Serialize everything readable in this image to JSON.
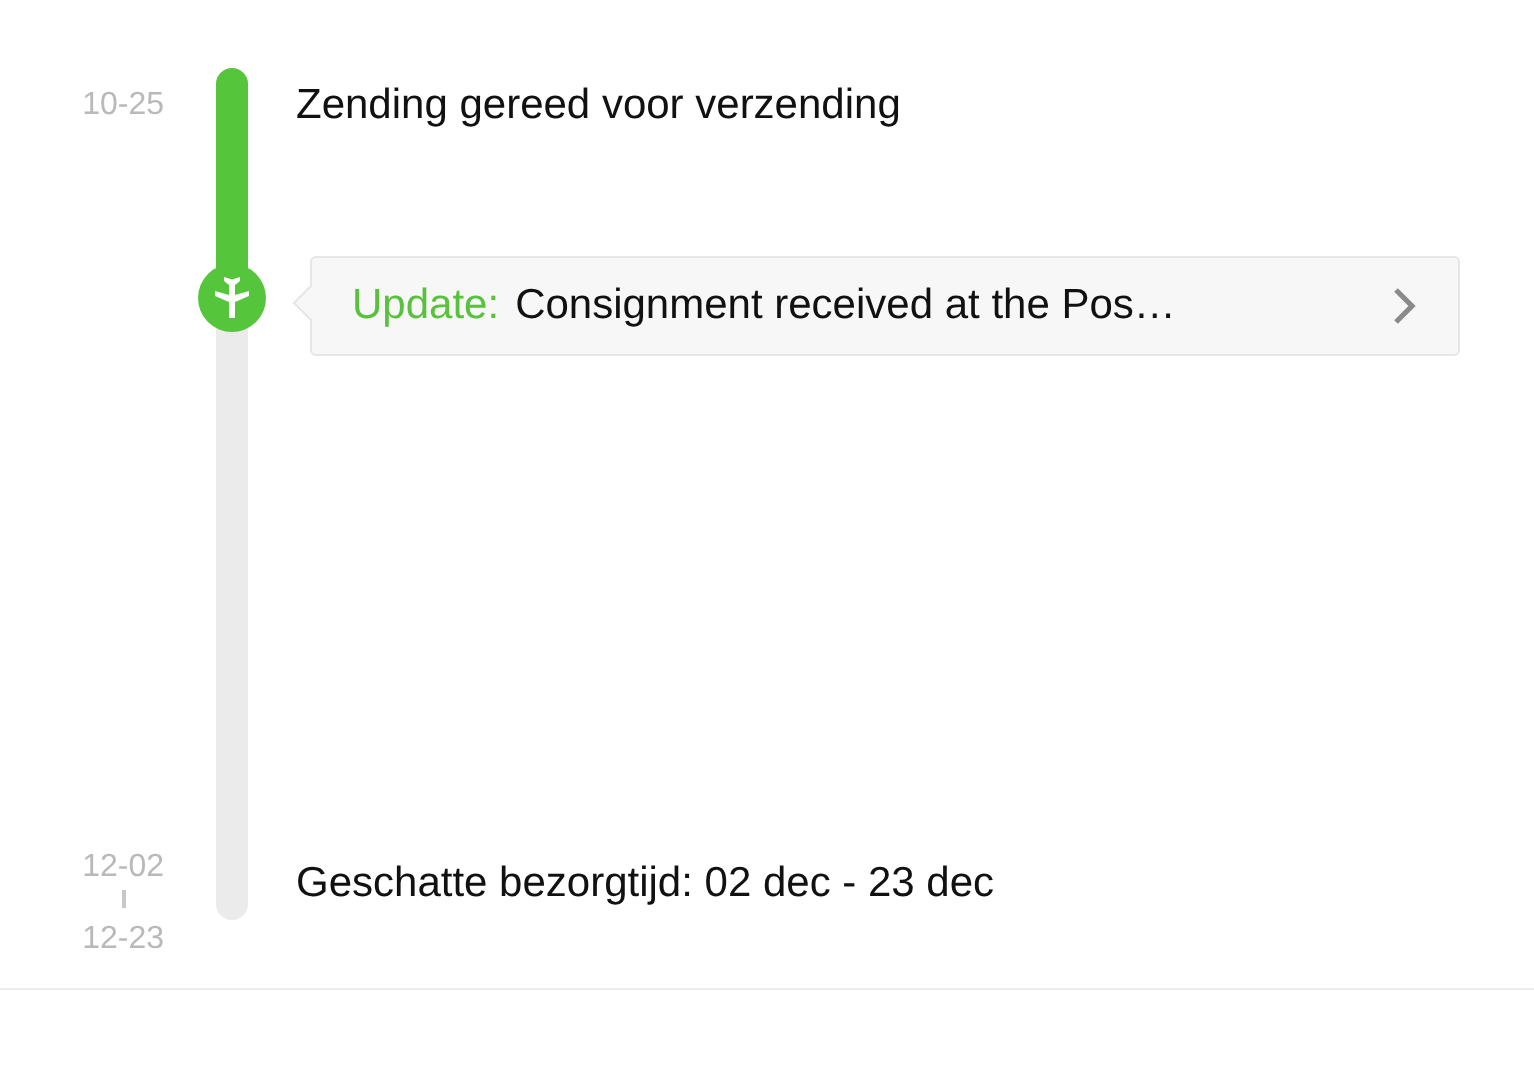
{
  "events": [
    {
      "kind": "status",
      "date": "10-25",
      "text": "Zending gereed voor verzending"
    },
    {
      "kind": "update",
      "label": "Update:",
      "text": "Consignment received at the Pos…"
    },
    {
      "kind": "estimate",
      "date_from": "12-02",
      "date_to": "12-23",
      "text": "Geschatte bezorgtijd: 02 dec - 23 dec"
    }
  ],
  "progress": {
    "level": 0.27
  }
}
